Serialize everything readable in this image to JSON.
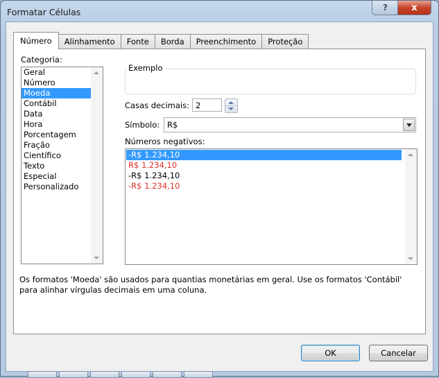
{
  "window": {
    "title": "Formatar Células",
    "help_button": "?",
    "close_button": "x"
  },
  "tabs": [
    {
      "label": "Número",
      "active": true
    },
    {
      "label": "Alinhamento",
      "active": false
    },
    {
      "label": "Fonte",
      "active": false
    },
    {
      "label": "Borda",
      "active": false
    },
    {
      "label": "Preenchimento",
      "active": false
    },
    {
      "label": "Proteção",
      "active": false
    }
  ],
  "category": {
    "label": "Categoria:",
    "items": [
      "Geral",
      "Número",
      "Moeda",
      "Contábil",
      "Data",
      "Hora",
      "Porcentagem",
      "Fração",
      "Científico",
      "Texto",
      "Especial",
      "Personalizado"
    ],
    "selected": "Moeda"
  },
  "example": {
    "label": "Exemplo",
    "value": ""
  },
  "decimal_places": {
    "label": "Casas decimais:",
    "value": "2"
  },
  "symbol": {
    "label": "Símbolo:",
    "value": "R$"
  },
  "negative_numbers": {
    "label": "Números negativos:",
    "items": [
      {
        "text": "-R$ 1.234,10",
        "color": "#000000",
        "selected": true
      },
      {
        "text": "R$ 1.234,10",
        "color": "#e0322b",
        "selected": false
      },
      {
        "text": "-R$ 1.234,10",
        "color": "#000000",
        "selected": false
      },
      {
        "text": "-R$ 1.234,10",
        "color": "#e0322b",
        "selected": false
      }
    ]
  },
  "description": "Os formatos 'Moeda' são usados para quantias monetárias em geral. Use os formatos 'Contábil' para alinhar vírgulas decimais em uma coluna.",
  "buttons": {
    "ok": "OK",
    "cancel": "Cancelar"
  }
}
